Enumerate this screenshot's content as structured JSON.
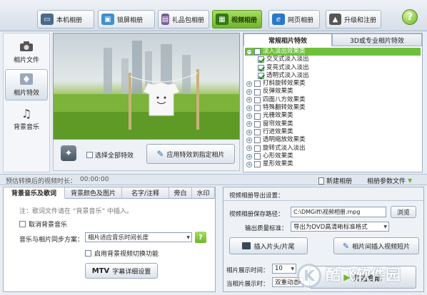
{
  "top_tabs": [
    {
      "label": "本机相册",
      "icon": "computer-icon",
      "active": false
    },
    {
      "label": "锁屏相册",
      "icon": "lock-screen-icon",
      "active": false
    },
    {
      "label": "礼品包相册",
      "icon": "gift-icon",
      "active": false
    },
    {
      "label": "视频相册",
      "icon": "film-icon",
      "active": true
    },
    {
      "label": "网页相册",
      "icon": "ie-icon",
      "active": false
    },
    {
      "label": "升级和注册",
      "icon": "upgrade-icon",
      "active": false
    }
  ],
  "help_label": "?",
  "sidebar": {
    "items": [
      {
        "label": "相片文件",
        "icon": "camera-icon"
      },
      {
        "label": "相片特效",
        "icon": "effects-icon"
      },
      {
        "label": "背景音乐",
        "icon": "music-note-icon"
      }
    ]
  },
  "controls": {
    "select_all_label": "选择全部特效",
    "apply_label": "应用特效到指定相片"
  },
  "effects": {
    "tab_regular": "常规相片特效",
    "tab_3d": "3D或专业相片特效",
    "rows": [
      {
        "label": "淡入淡出效果类",
        "kind": "group",
        "expanded": true,
        "selected": true
      },
      {
        "label": "交叉式淡入淡出",
        "kind": "sub",
        "checked": true
      },
      {
        "label": "变亮式淡入淡出",
        "kind": "sub",
        "checked": true
      },
      {
        "label": "透明式淡入淡出",
        "kind": "sub",
        "checked": true
      },
      {
        "label": "打斜旋转效果类",
        "kind": "group"
      },
      {
        "label": "反弹效果类",
        "kind": "group"
      },
      {
        "label": "四面八方效果类",
        "kind": "group"
      },
      {
        "label": "特殊翻转效果类",
        "kind": "group"
      },
      {
        "label": "光栅效果类",
        "kind": "group"
      },
      {
        "label": "窗帘效果类",
        "kind": "group"
      },
      {
        "label": "行进效果类",
        "kind": "group"
      },
      {
        "label": "透明缩放效果类",
        "kind": "group"
      },
      {
        "label": "旋转式淡入淡出",
        "kind": "group"
      },
      {
        "label": "心形效果类",
        "kind": "group"
      },
      {
        "label": "星形效果类",
        "kind": "group"
      }
    ]
  },
  "strip": {
    "estimate_label": "预估转换后的视频时长：",
    "estimate_value": "00:00:00",
    "new_album_label": "新建相册",
    "param_file_label": "相册参数文件"
  },
  "bottom_tabs": {
    "tabs": [
      "背景音乐及歌词",
      "背景颜色及图片",
      "名字/注释",
      "旁白",
      "水印"
    ],
    "note": "注：歌词文件请在 “背景音乐” 中插入。",
    "cancel_music_label": "取消背景音乐",
    "sync_label": "音乐与相片同步方案：",
    "sync_value": "相片适应音乐时间长度",
    "sync_help": "?",
    "bg_video_label": "启用背景视频切换功能",
    "mtv_label": "MTV",
    "subtitle_settings_label": "字幕详细设置"
  },
  "export": {
    "title": "视频相册导出设置：",
    "save_path_label": "视频相册保存路径：",
    "save_path_value": "C:\\DMGift\\视频相册.mpg",
    "browse_label": "浏览",
    "quality_label": "输出质量标准：",
    "quality_value": "导出为DVD高清晰标准格式",
    "insert_head_tail_label": "插入片头/片尾",
    "insert_video_label": "相片间插入视频短片",
    "show_time_label": "相片展示时间：",
    "show_time_value": "10",
    "effect_label": "当相片展示时：",
    "effect_value": "双重动态",
    "bottom_button_partial": "开始合成"
  },
  "watermark": {
    "text": "酷飞软件园",
    "url": "www.KUYISOFT.com"
  },
  "colors": {
    "accent_green": "#6fb52a",
    "selected_row": "#6fc03a"
  }
}
